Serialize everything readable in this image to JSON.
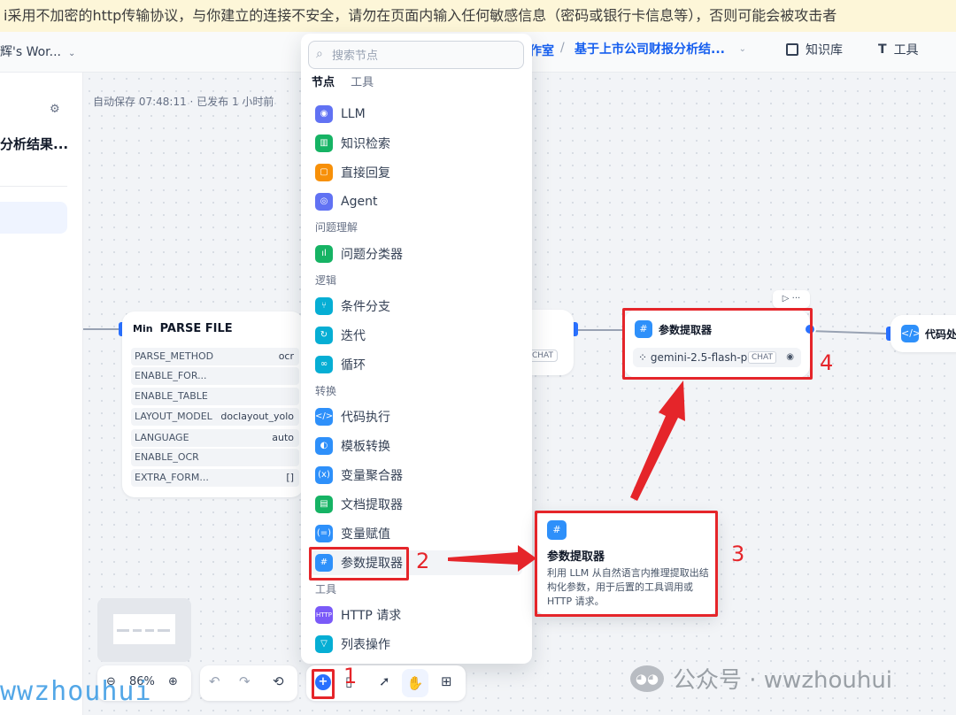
{
  "security_warning": "i采用不加密的http传输协议，与你建立的连接不安全，请勿在页面内输入任何敏感信息（密码或银行卡信息等），否则可能会被攻击者",
  "header": {
    "workspace": "辉's Wor...",
    "breadcrumb_studio": "作室",
    "breadcrumb_sep": "/",
    "app_name": "基于上市公司财报分析结...",
    "knowledge_label": "知识库",
    "tools_label": "工具"
  },
  "sidebar": {
    "app_title": "分析结果...",
    "settings_icon": "settings-sliders-icon"
  },
  "canvas": {
    "autosave": "自动保存 07:48:11 · 已发布 1 小时前"
  },
  "parse_node": {
    "tag": "Min",
    "title": "PARSE FILE",
    "rows": [
      {
        "key": "PARSE_METHOD",
        "value": "ocr"
      },
      {
        "key": "ENABLE_FOR...",
        "value": ""
      },
      {
        "key": "ENABLE_TABLE",
        "value": ""
      },
      {
        "key": "LAYOUT_MODEL",
        "value": "doclayout_yolo"
      },
      {
        "key": "LANGUAGE",
        "value": "auto"
      },
      {
        "key": "ENABLE_OCR",
        "value": ""
      },
      {
        "key": "EXTRA_FORM...",
        "value": "[]"
      }
    ]
  },
  "hidden_node": {
    "chat_badge": "CHAT"
  },
  "param_node": {
    "title": "参数提取器",
    "model": "gemini-2.5-flash-pr...",
    "chat_badge": "CHAT",
    "toolbar": "▷ ···"
  },
  "code_node": {
    "title": "代码处"
  },
  "picker": {
    "search_placeholder": "搜索节点",
    "tabs": [
      "节点",
      "工具"
    ],
    "groups": {
      "understanding": "问题理解",
      "logic": "逻辑",
      "transform": "转换",
      "tools": "工具"
    },
    "items": {
      "llm": "LLM",
      "knowledge": "知识检索",
      "answer": "直接回复",
      "agent": "Agent",
      "classifier": "问题分类器",
      "ifelse": "条件分支",
      "iteration": "迭代",
      "loop": "循环",
      "code": "代码执行",
      "template": "模板转换",
      "aggregator": "变量聚合器",
      "doc_extractor": "文档提取器",
      "assigner": "变量赋值",
      "param_extractor": "参数提取器",
      "http": "HTTP 请求",
      "list_op": "列表操作"
    }
  },
  "tooltip": {
    "title": "参数提取器",
    "description": "利用 LLM 从自然语言内推理提取出结构化参数，用于后置的工具调用或 HTTP 请求。"
  },
  "zoom": {
    "value": "86%"
  },
  "annotations": [
    "1",
    "2",
    "3",
    "4"
  ],
  "watermarks": {
    "left": "wwzhouhui",
    "right": "公众号 · wwzhouhui"
  },
  "colors": {
    "accent": "#2970ff",
    "annotation_red": "#e5252a",
    "warning_bg": "#fdf6d8"
  }
}
